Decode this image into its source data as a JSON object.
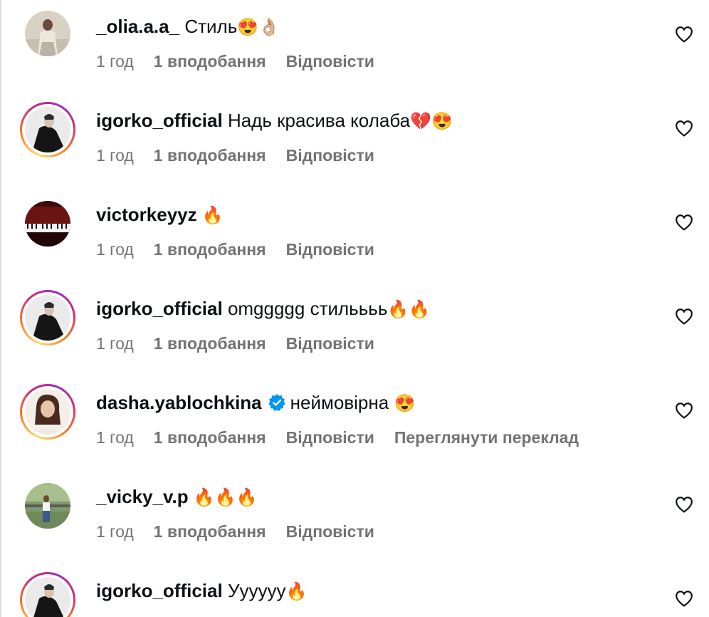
{
  "comments": [
    {
      "username": "_olia.a.a_",
      "text": "Стиль",
      "emoji": "😍👌🏼",
      "time": "1 год",
      "likes": "1 вподобання",
      "reply": "Відповісти",
      "story": false,
      "avatar": "olia"
    },
    {
      "username": "igorko_official",
      "text": "Надь красива колаба",
      "emoji": "💔😍",
      "time": "1 год",
      "likes": "1 вподобання",
      "reply": "Відповісти",
      "story": true,
      "avatar": "igor"
    },
    {
      "username": "victorkeyyz",
      "text": "",
      "emoji": "🔥",
      "time": "1 год",
      "likes": "1 вподобання",
      "reply": "Відповісти",
      "story": false,
      "avatar": "piano"
    },
    {
      "username": "igorko_official",
      "text": "omggggg стильььь",
      "emoji": "🔥🔥",
      "time": "1 год",
      "likes": "1 вподобання",
      "reply": "Відповісти",
      "story": true,
      "avatar": "igor"
    },
    {
      "username": "dasha.yablochkina",
      "text": "неймовірна",
      "emoji": "😍",
      "time": "1 год",
      "likes": "1 вподобання",
      "reply": "Відповісти",
      "translate": "Переглянути переклад",
      "story": true,
      "verified": true,
      "avatar": "dasha"
    },
    {
      "username": "_vicky_v.p",
      "text": "",
      "emoji": "🔥🔥🔥",
      "time": "1 год",
      "likes": "1 вподобання",
      "reply": "Відповісти",
      "story": false,
      "avatar": "vicky"
    },
    {
      "username": "igorko_official",
      "text": "Уууууу",
      "emoji": "🔥",
      "time": "",
      "likes": "",
      "reply": "",
      "story": true,
      "avatar": "igor"
    }
  ]
}
